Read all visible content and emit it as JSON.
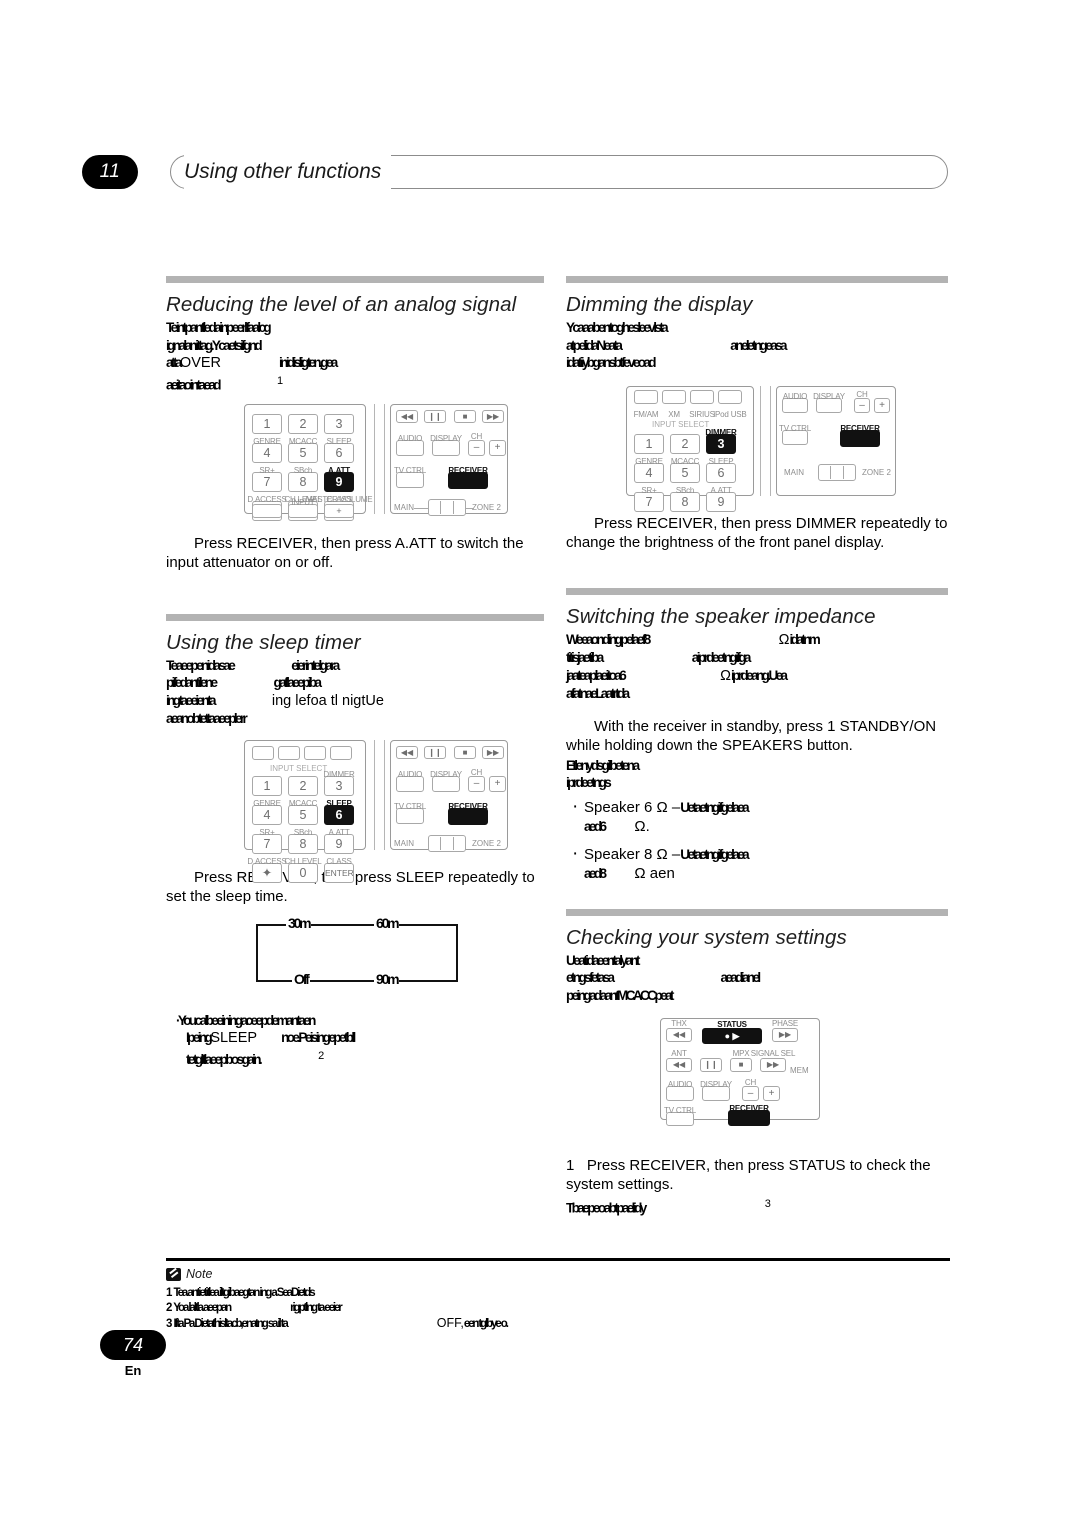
{
  "header": {
    "chapter_number": "11",
    "chapter_title": "Using other functions"
  },
  "footer": {
    "page_number": "74",
    "language_code": "En"
  },
  "left_column": {
    "section_analog": {
      "title": "Reducing the level of an analog signal",
      "intro_lines": [
        "Te intpantleda inpeerl fa alcg",
        "ignalan ittag.Yca e tsifgnd",
        "a tta",
        "inidisligten,gea",
        "aeitao in ta ead"
      ],
      "intro_keyword": "OVER",
      "footnote_ref": "1",
      "instruction": "Press RECEIVER, then press A.ATT to switch the input attenuator on or off.",
      "instruction_kw1": "RECEIVER",
      "instruction_kw2": "A.ATT"
    },
    "section_sleep": {
      "title": "Using the sleep timer",
      "intro_lines": [
        "Te aeepenidasa e",
        "eierintelgara",
        "pifedantilene",
        "ga fl aeepiba",
        "ing ta eeienta",
        "ing lefoa tl nigtUe",
        "a eanobtetta aeeplerr"
      ],
      "instruction": "Press RECEIVER, then press SLEEP repeatedly to set the sleep time.",
      "instruction_kw1": "RECEIVER",
      "instruction_kw2": "SLEEP",
      "flow": {
        "top_left": "30m",
        "top_right": "60m",
        "bottom_left": "Off",
        "bottom_right": "90m"
      },
      "tip_lines": [
        "You calbe eining aceepdemantaen",
        "Ipeing",
        "noe.Peising epetbll",
        "te tgltl aeepbo sgain."
      ],
      "tip_keyword": "SLEEP",
      "tip_footnote_ref": "2"
    },
    "remote_attenuator": {
      "highlight_key": "9",
      "highlight_label": "A.ATT",
      "highlight_receiver": "RECEIVER"
    },
    "remote_sleep": {
      "highlight_key": "6",
      "highlight_label": "SLEEP",
      "highlight_receiver": "RECEIVER"
    }
  },
  "right_column": {
    "section_dimmer": {
      "title": "Dimming the display",
      "intro_lines": [
        "Yca a aben toghesleevlsta",
        "atpel idaNea ta",
        "an eletng easa",
        "idatiiybgansbtfeveoad"
      ],
      "instruction": "Press RECEIVER, then press DIMMER repeatedly to change the brightness of the front panel display.",
      "instruction_kw1": "RECEIVER",
      "instruction_kw2": "DIMMER"
    },
    "section_impedance": {
      "title": "Switching the speaker impedance",
      "intro_lines": [
        "We eaonding pelaef8",
        "idatnm",
        "titisjae tiba",
        "a iprde etng ifga",
        "jaa tea plaeitoa6",
        "iprde ang.Uea",
        "a fatnaeL aatrtda"
      ],
      "ohm_symbol": "Ω",
      "instruction": "With the receiver in standby, press  1 STANDBY/ON while holding down the  SPEAKERS button.",
      "instruction_kw1": "STANDBY/",
      "instruction_kw2": "SPEAKERS",
      "sub_lines": [
        "Etlenydsgilbeten a",
        "iprde etngs"
      ],
      "bullets": [
        {
          "lead": "Speaker 6 Ω –",
          "garbled": "Ue taetng ifgelaea",
          "garbled2": "aed6",
          "tail": "Ω."
        },
        {
          "lead": "Speaker 8 Ω –",
          "garbled": "Ue taetng ifgelaea",
          "garbled2": "aed8",
          "tail": "Ω aen"
        }
      ]
    },
    "section_system": {
      "title": "Checking your system settings",
      "intro_lines": [
        "Ue a tidaeen talyant",
        "etngsfetasa",
        "aeadianel",
        "peing adaantMCACC peat"
      ],
      "step_number": "1",
      "instruction": "Press RECEIVER, then press STATUS to check the system settings.",
      "instruction_kw1": "RECEIVER",
      "instruction_kw2": "STATUS",
      "tail_lines": [
        "Tbae peo a btpael idy"
      ],
      "tail_footnote_ref": "3"
    },
    "remote_dimmer": {
      "highlight_key": "3",
      "highlight_label": "DIMMER",
      "highlight_receiver": "RECEIVER"
    },
    "remote_status": {
      "highlight_label": "STATUS",
      "highlight_receiver": "RECEIVER"
    }
  },
  "remote_keys": {
    "source_row": [
      "FM/AM",
      "XM",
      "SIRIUS",
      "iPod USB"
    ],
    "input_select": "INPUT SELECT",
    "row1_labels": [
      "",
      "",
      "DIMMER"
    ],
    "row1_keys": [
      "1",
      "2",
      "3"
    ],
    "row2_labels": [
      "GENRE",
      "MCACC",
      "SLEEP"
    ],
    "row2_keys": [
      "4",
      "5",
      "6"
    ],
    "row3_labels": [
      "SR+",
      "SBch",
      "A.ATT"
    ],
    "row3_keys": [
      "7",
      "8",
      "9"
    ],
    "row4_labels": [
      "D.ACCESS",
      "CH LEVEL",
      "CLASS"
    ],
    "row4_keys": [
      "✦",
      "0",
      "ENTER"
    ],
    "row5_labels": [
      "",
      "INPUT",
      "MASTER VOLUME"
    ],
    "transport_labels": [
      "THX",
      "STATUS",
      "PHASE"
    ],
    "transport_labels2": [
      "ANT",
      "",
      "MPX",
      "SIGNAL SEL"
    ],
    "audio_label": "AUDIO",
    "display_label": "DISPLAY",
    "ch_label": "CH",
    "ch_minus": "–",
    "ch_plus": "+",
    "tv_ctrl_label": "TV CTRL",
    "receiver_label": "RECEIVER",
    "mem_label": "MEM",
    "main_label": "MAIN",
    "zone_label": "ZONE 2"
  },
  "notes": {
    "label": "Note",
    "items": [
      {
        "num": "1",
        "text": "Tea antietitlea iltgibaegtan ing a SeaDietds"
      },
      {
        "num": "2",
        "text": "Yoa laltla aeepan",
        "text2": "rigptlng ta eeier"
      },
      {
        "num": "3",
        "text": "Ifta Pa Dietathisltacb,enatng sa il ta",
        "keyword": "OFF,",
        "text2": "een tglbye o."
      }
    ]
  }
}
